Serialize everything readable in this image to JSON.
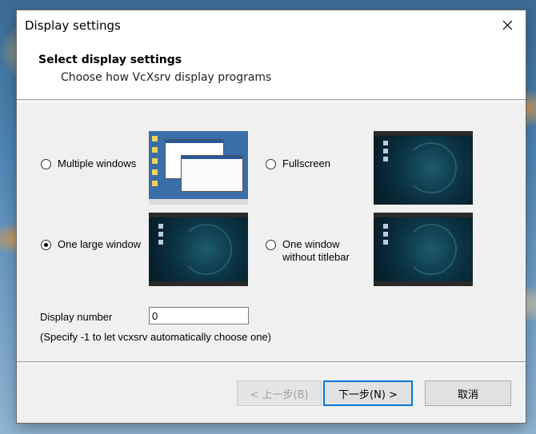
{
  "window": {
    "title": "Display settings"
  },
  "header": {
    "title": "Select display settings",
    "subtitle": "Choose how VcXsrv display programs"
  },
  "options": [
    {
      "label_lines": [
        "Multiple windows"
      ],
      "checked": false,
      "preview": "multiple-windows"
    },
    {
      "label_lines": [
        "Fullscreen"
      ],
      "checked": false,
      "preview": "fullscreen"
    },
    {
      "label_lines": [
        "One large window"
      ],
      "checked": true,
      "preview": "one-large-window"
    },
    {
      "label_lines": [
        "One window",
        "without titlebar"
      ],
      "checked": false,
      "preview": "one-window-no-titlebar"
    }
  ],
  "display": {
    "label": "Display number",
    "value": "0",
    "hint": "(Specify -1 to let vcxsrv automatically choose one)"
  },
  "buttons": {
    "back": "< 上一步(B)",
    "next": "下一步(N) >",
    "cancel": "取消"
  },
  "colors": {
    "accent": "#0078d7",
    "dialog_bg": "#f0f0f0"
  }
}
